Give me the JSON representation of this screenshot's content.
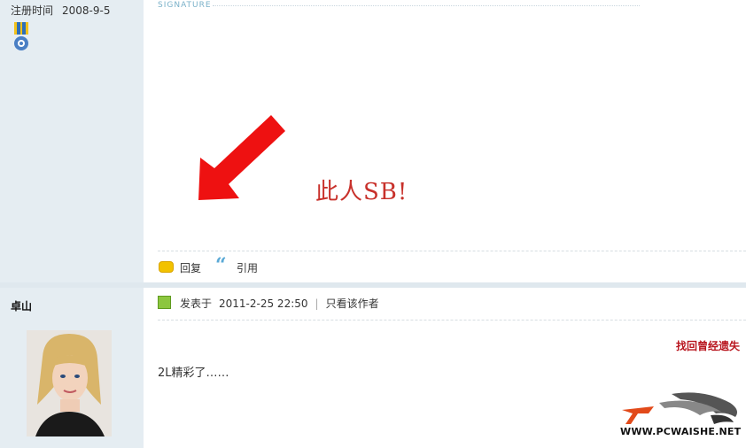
{
  "profile_top": {
    "reg_label": "注册时间",
    "reg_date": "2008-9-5"
  },
  "signature": {
    "label": "SIGNATURE",
    "text": "此人SB!"
  },
  "actions": {
    "reply": "回复",
    "quote": "引用"
  },
  "next_post": {
    "username": "卓山",
    "posted_label": "发表于",
    "date": "2011-2-25 22:50",
    "separator": "|",
    "author_only": "只看该作者",
    "red_link": "找回曾经遗失",
    "content": "2L精彩了……"
  },
  "watermark": {
    "text": "WWW.PCWAISHE.NET"
  },
  "colors": {
    "sidebar_bg": "#e5edf2",
    "signature_red": "#c8312b",
    "link_red": "#b8141d",
    "arrow_red": "#ee1111"
  }
}
